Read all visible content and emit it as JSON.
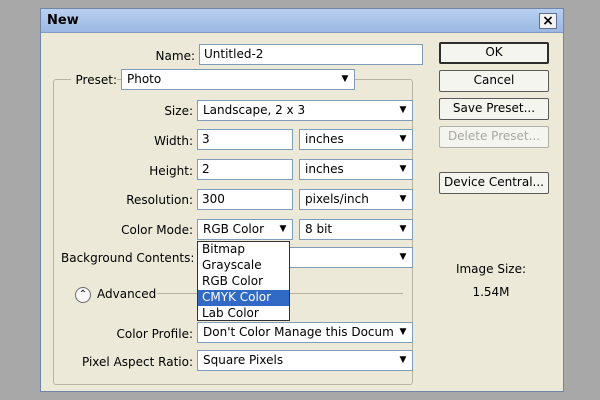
{
  "dialog": {
    "title": "New",
    "close_label": "×"
  },
  "form": {
    "name_label": "Name:",
    "name_value": "Untitled-2",
    "preset_label": "Preset:",
    "preset_value": "Photo",
    "size_label": "Size:",
    "size_value": "Landscape, 2 x 3",
    "width_label": "Width:",
    "width_value": "3",
    "width_unit": "inches",
    "height_label": "Height:",
    "height_value": "2",
    "height_unit": "inches",
    "resolution_label": "Resolution:",
    "resolution_value": "300",
    "resolution_unit": "pixels/inch",
    "color_mode_label": "Color Mode:",
    "color_mode_value": "RGB Color",
    "bit_depth_value": "8 bit",
    "background_label": "Background Contents:",
    "background_value": "",
    "advanced_label": "Advanced",
    "color_profile_label": "Color Profile:",
    "color_profile_value": "Don't Color Manage this Document",
    "pixel_aspect_label": "Pixel Aspect Ratio:",
    "pixel_aspect_value": "Square Pixels"
  },
  "color_mode_menu": {
    "options": [
      "Bitmap",
      "Grayscale",
      "RGB Color",
      "CMYK Color",
      "Lab Color"
    ],
    "highlighted": "CMYK Color"
  },
  "buttons": {
    "ok": "OK",
    "cancel": "Cancel",
    "save_preset": "Save Preset...",
    "delete_preset": "Delete Preset...",
    "device_central": "Device Central..."
  },
  "info": {
    "image_size_label": "Image Size:",
    "image_size_value": "1.54M"
  },
  "icons": {
    "dropdown": "chevron-down-icon",
    "advanced_toggle": "chevron-up-circle-icon",
    "close": "close-icon"
  },
  "colors": {
    "title_bar": "#9cb8e2",
    "selection": "#316ac5",
    "dialog_bg": "#ece9d8"
  }
}
